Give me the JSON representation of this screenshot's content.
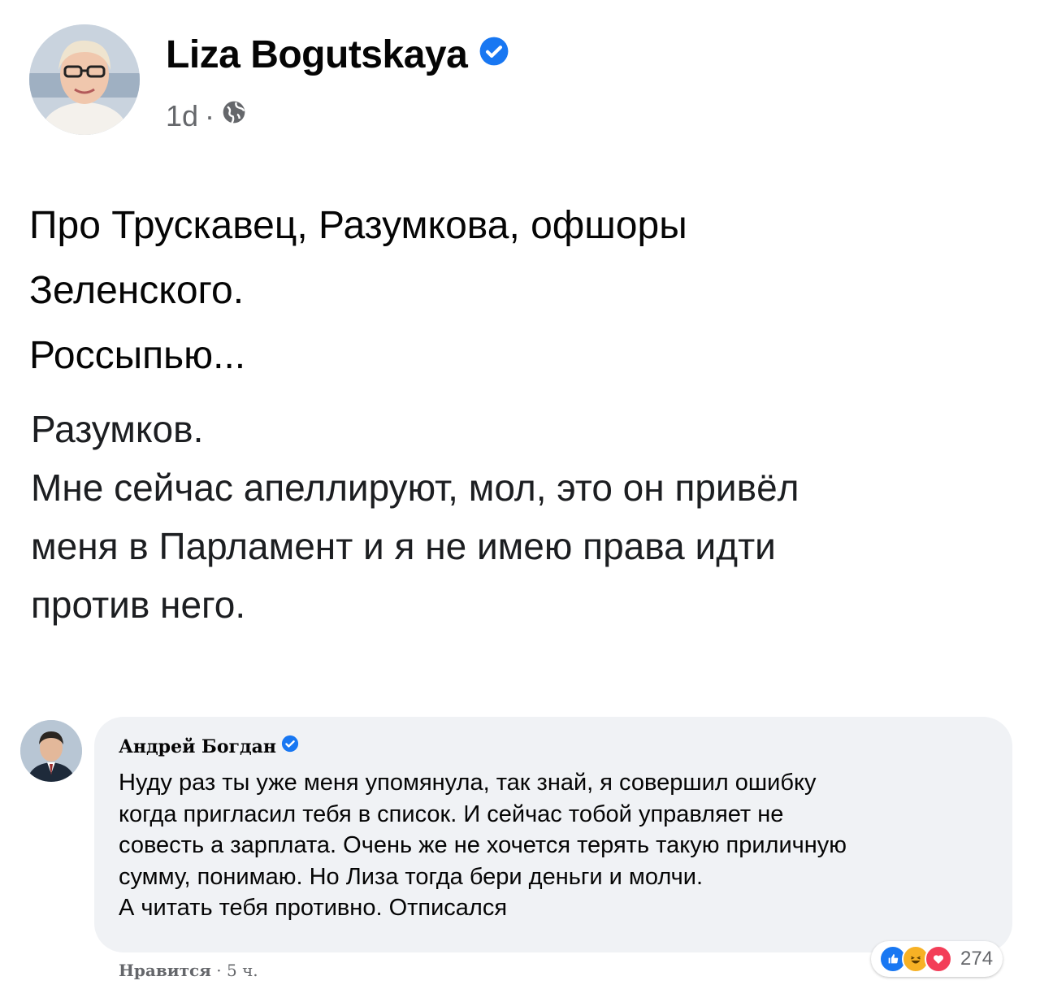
{
  "post": {
    "author": "Liza Bogutskaya",
    "time": "1d",
    "separator": "·",
    "icons": {
      "verified": "verified-badge-icon",
      "audience": "globe-icon"
    },
    "paragraphs": [
      "Про Трускавец, Разумкова, офшоры",
      "Зеленского.",
      "Россыпью..."
    ],
    "quote_lines": [
      "Разумков.",
      "Мне сейчас апеллируют, мол, это он привёл",
      "меня в Парламент и я не имею права идти",
      "против него."
    ]
  },
  "comment": {
    "author": "Андрей Богдан",
    "lines": [
      "Нуду раз ты уже меня упомянула, так знай, я совершил ошибку",
      "когда пригласил тебя в список. И сейчас тобой управляет не",
      "совесть а зарплата. Очень же не хочется терять такую приличную",
      "сумму, понимаю. Но Лиза тогда бери деньги и молчи.",
      "А читать тебя противно. Отписался"
    ],
    "like_label": "Нравится",
    "separator": "·",
    "time": "5 ч.",
    "reaction_count": "274",
    "reactions": [
      "like",
      "haha",
      "love"
    ],
    "colors": {
      "like": "#1877f2",
      "haha": "#f7b125",
      "love": "#f33e58"
    }
  }
}
